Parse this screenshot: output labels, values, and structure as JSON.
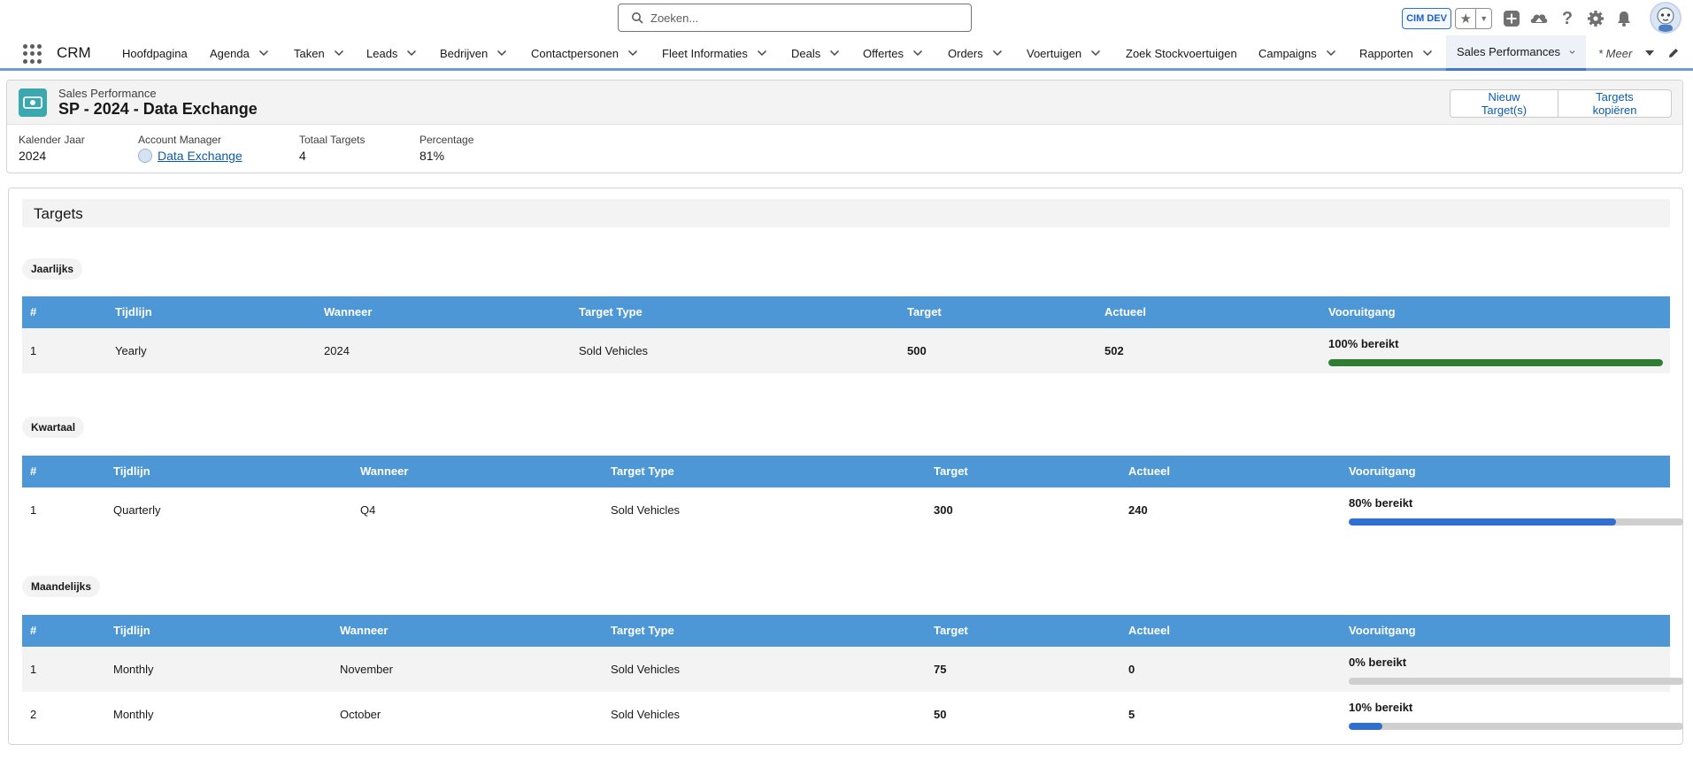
{
  "header": {
    "search_placeholder": "Zoeken...",
    "org_badge": "CIM DEV",
    "icons": [
      "star-icon",
      "caret-down-icon",
      "plus-icon",
      "trailhead-icon",
      "help-icon",
      "gear-icon",
      "bell-icon",
      "avatar"
    ]
  },
  "nav": {
    "app_name": "CRM",
    "items": [
      {
        "label": "Hoofdpagina",
        "chevron": false
      },
      {
        "label": "Agenda",
        "chevron": true
      },
      {
        "label": "Taken",
        "chevron": true
      },
      {
        "label": "Leads",
        "chevron": true
      },
      {
        "label": "Bedrijven",
        "chevron": true
      },
      {
        "label": "Contactpersonen",
        "chevron": true
      },
      {
        "label": "Fleet Informaties",
        "chevron": true
      },
      {
        "label": "Deals",
        "chevron": true
      },
      {
        "label": "Offertes",
        "chevron": true
      },
      {
        "label": "Orders",
        "chevron": true
      },
      {
        "label": "Voertuigen",
        "chevron": true
      },
      {
        "label": "Zoek Stockvoertuigen",
        "chevron": false
      },
      {
        "label": "Campaigns",
        "chevron": true
      },
      {
        "label": "Rapporten",
        "chevron": true
      },
      {
        "label": "Sales Performances",
        "chevron": true,
        "active": true
      }
    ],
    "more_label": "* Meer"
  },
  "record": {
    "type_label": "Sales Performance",
    "title": "SP - 2024 - Data Exchange",
    "buttons": {
      "new_target": "Nieuw Target(s)",
      "copy_targets": "Targets kopiëren"
    },
    "fields": [
      {
        "label": "Kalender Jaar",
        "value": "2024"
      },
      {
        "label": "Account Manager",
        "value": "Data Exchange"
      },
      {
        "label": "Totaal Targets",
        "value": "4"
      },
      {
        "label": "Percentage",
        "value": "81%"
      }
    ]
  },
  "targets": {
    "title": "Targets",
    "headers": {
      "idx": "#",
      "timeline": "Tijdlijn",
      "when": "Wanneer",
      "type": "Target Type",
      "target": "Target",
      "actual": "Actueel",
      "progress": "Vooruitgang"
    },
    "sections": [
      {
        "label": "Jaarlijks",
        "color": "#2e7d32",
        "rows": [
          {
            "idx": "1",
            "timeline": "Yearly",
            "when": "2024",
            "type": "Sold Vehicles",
            "target": "500",
            "actual": "502",
            "progress_label": "100% bereikt",
            "progress": 1.0
          }
        ]
      },
      {
        "label": "Kwartaal",
        "color": "#2f6fd2",
        "rows": [
          {
            "idx": "1",
            "timeline": "Quarterly",
            "when": "Q4",
            "type": "Sold Vehicles",
            "target": "300",
            "actual": "240",
            "progress_label": "80% bereikt",
            "progress": 0.8
          }
        ]
      },
      {
        "label": "Maandelijks",
        "color": "#2f6fd2",
        "rows": [
          {
            "idx": "1",
            "timeline": "Monthly",
            "when": "November",
            "type": "Sold Vehicles",
            "target": "75",
            "actual": "0",
            "progress_label": "0% bereikt",
            "progress": 0.0
          },
          {
            "idx": "2",
            "timeline": "Monthly",
            "when": "October",
            "type": "Sold Vehicles",
            "target": "50",
            "actual": "5",
            "progress_label": "10% bereikt",
            "progress": 0.1
          }
        ]
      }
    ]
  }
}
